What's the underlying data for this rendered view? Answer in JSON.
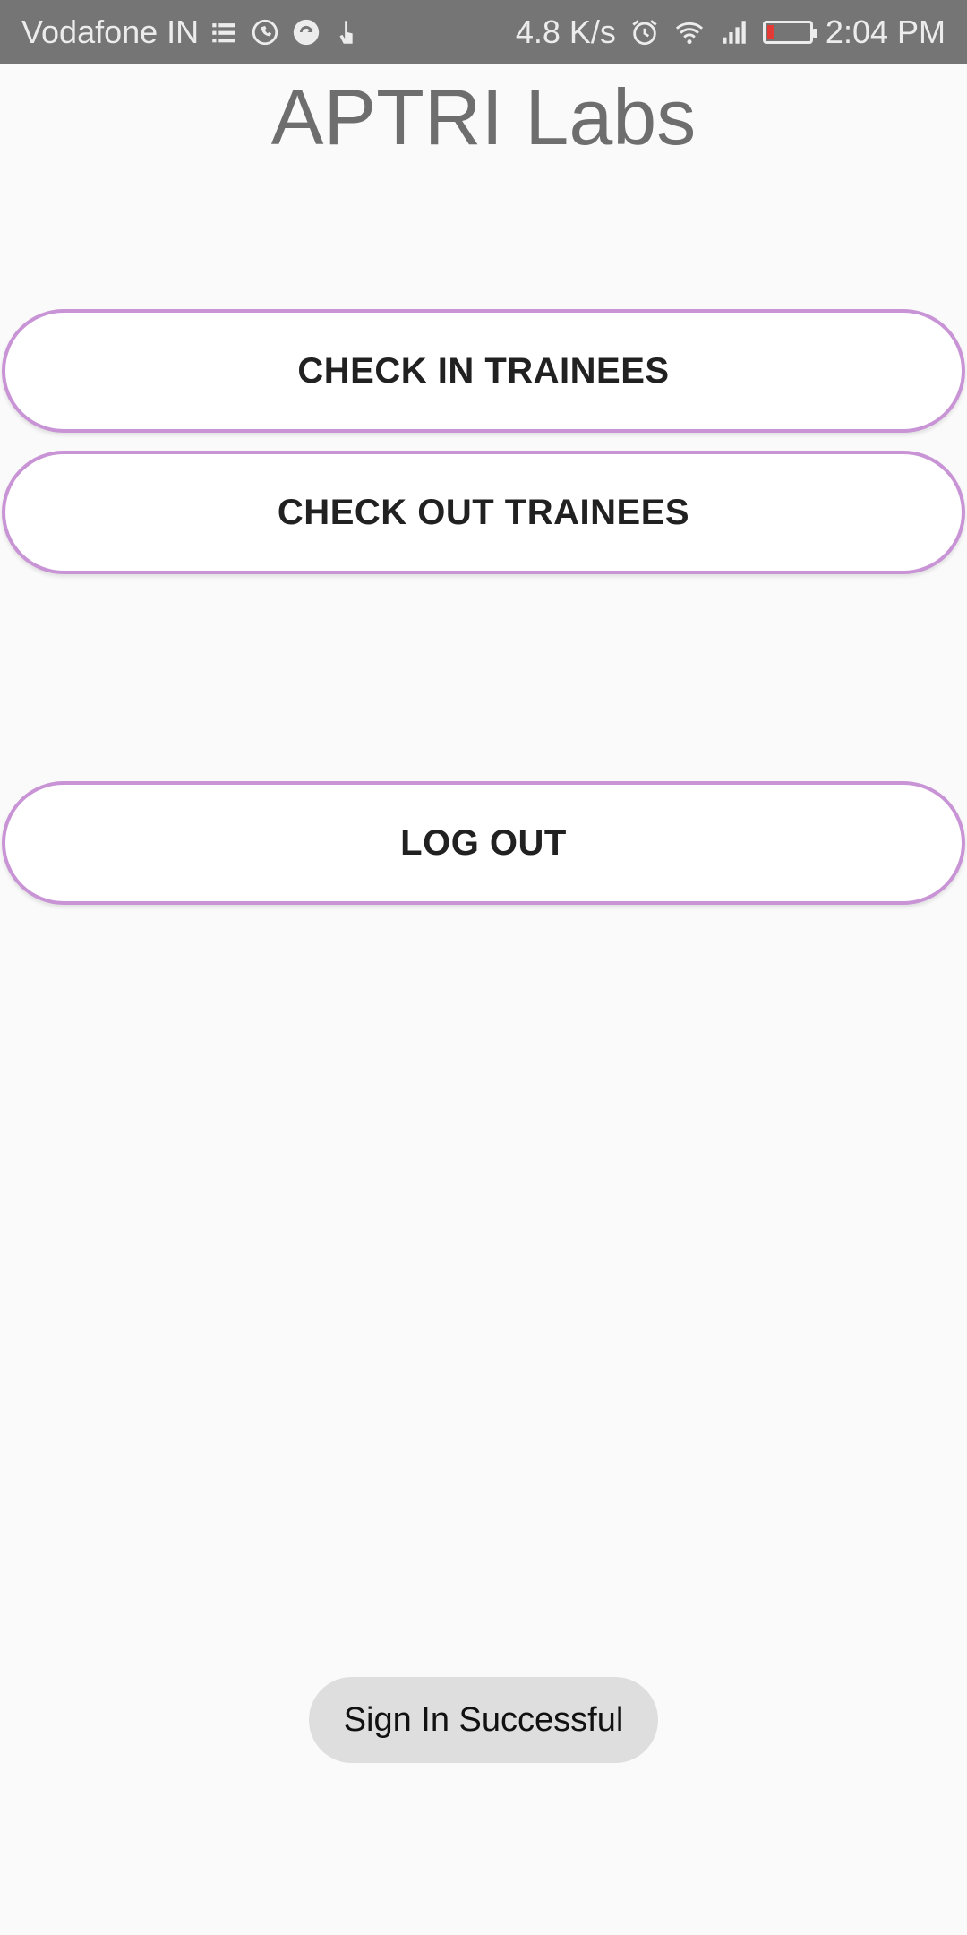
{
  "status_bar": {
    "carrier": "Vodafone IN",
    "net_speed": "4.8 K/s",
    "time": "2:04 PM",
    "left_icons": [
      "list-icon",
      "whatsapp-icon",
      "sync-icon",
      "touch-icon"
    ],
    "right_icons": [
      "alarm-icon",
      "wifi-icon",
      "signal-icon",
      "battery-icon"
    ],
    "battery_color": "#e53935"
  },
  "app": {
    "title": "APTRI Labs"
  },
  "buttons": {
    "check_in": "CHECK IN TRAINEES",
    "check_out": "CHECK OUT TRAINEES",
    "log_out": "LOG OUT"
  },
  "toast": {
    "message": "Sign In Successful"
  },
  "colors": {
    "status_bar_bg": "#757575",
    "background": "#fafafa",
    "button_border": "#c994d6",
    "toast_bg": "#dedede"
  }
}
